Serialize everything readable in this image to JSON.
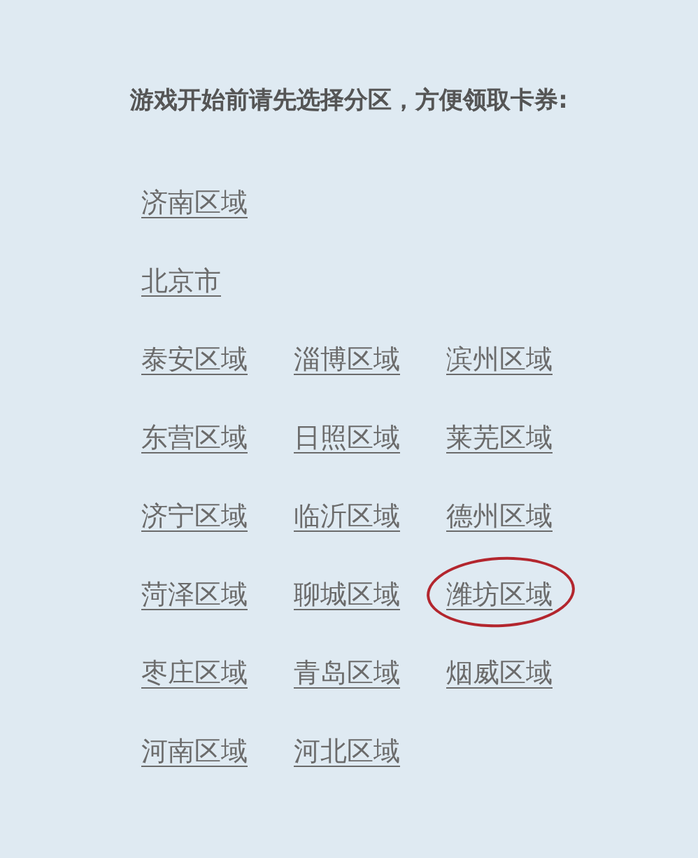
{
  "heading": "游戏开始前请先选择分区，方便领取卡券:",
  "rows": [
    [
      {
        "label": "济南区域",
        "circled": false
      }
    ],
    [
      {
        "label": "北京市",
        "circled": false
      }
    ],
    [
      {
        "label": "泰安区域",
        "circled": false
      },
      {
        "label": "淄博区域",
        "circled": false
      },
      {
        "label": "滨州区域",
        "circled": false
      }
    ],
    [
      {
        "label": "东营区域",
        "circled": false
      },
      {
        "label": "日照区域",
        "circled": false
      },
      {
        "label": "莱芜区域",
        "circled": false
      }
    ],
    [
      {
        "label": "济宁区域",
        "circled": false
      },
      {
        "label": "临沂区域",
        "circled": false
      },
      {
        "label": "德州区域",
        "circled": false
      }
    ],
    [
      {
        "label": "菏泽区域",
        "circled": false
      },
      {
        "label": "聊城区域",
        "circled": false
      },
      {
        "label": "潍坊区域",
        "circled": true
      }
    ],
    [
      {
        "label": "枣庄区域",
        "circled": false
      },
      {
        "label": "青岛区域",
        "circled": false
      },
      {
        "label": "烟威区域",
        "circled": false
      }
    ],
    [
      {
        "label": "河南区域",
        "circled": false
      },
      {
        "label": "河北区域",
        "circled": false
      }
    ]
  ]
}
